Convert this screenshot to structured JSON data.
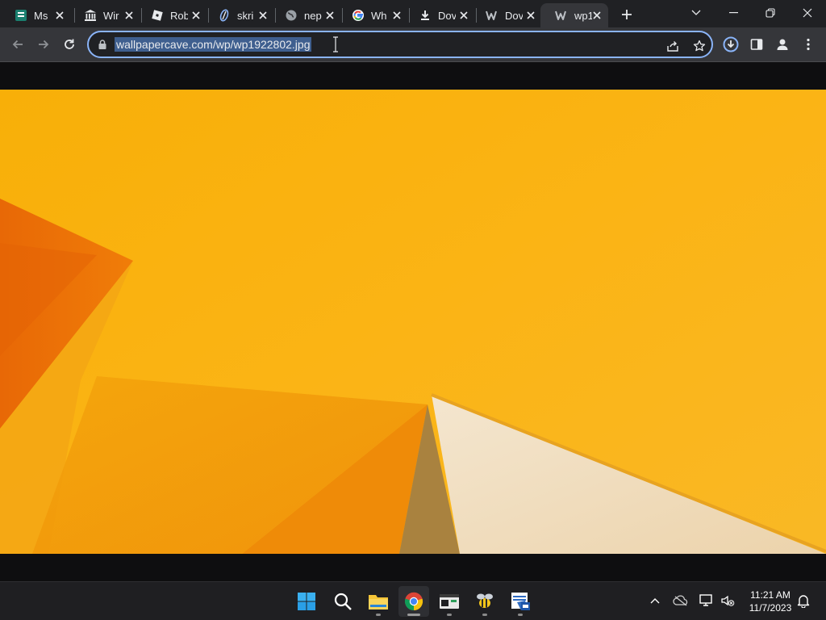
{
  "browser": {
    "tabs": [
      {
        "label": "Ms",
        "icon": "document-icon"
      },
      {
        "label": "Wir",
        "icon": "museum-icon"
      },
      {
        "label": "Rob",
        "icon": "roblox-icon"
      },
      {
        "label": "skri",
        "icon": "pen-icon"
      },
      {
        "label": "nep",
        "icon": "globe-icon"
      },
      {
        "label": "Wh",
        "icon": "google-icon"
      },
      {
        "label": "Dov",
        "icon": "download-icon"
      },
      {
        "label": "Dov",
        "icon": "wallpapercave-icon"
      },
      {
        "label": "wp1",
        "icon": "wallpapercave-icon",
        "active": true
      }
    ],
    "address": {
      "url": "wallpapercave.com/wp/wp1922802.jpg"
    }
  },
  "colors": {
    "accent": "#8ab4f8",
    "tab_strip": "#202124",
    "toolbar": "#35363a",
    "wallpaper_orange": "#f9b10b"
  },
  "taskbar": {
    "apps": [
      "start-icon",
      "search-icon",
      "file-explorer-icon",
      "chrome-icon",
      "terminal-app-icon",
      "bee-app-icon",
      "spreadsheet-app-icon"
    ],
    "clock": {
      "time": "11:21 AM",
      "date": "11/7/2023"
    }
  }
}
